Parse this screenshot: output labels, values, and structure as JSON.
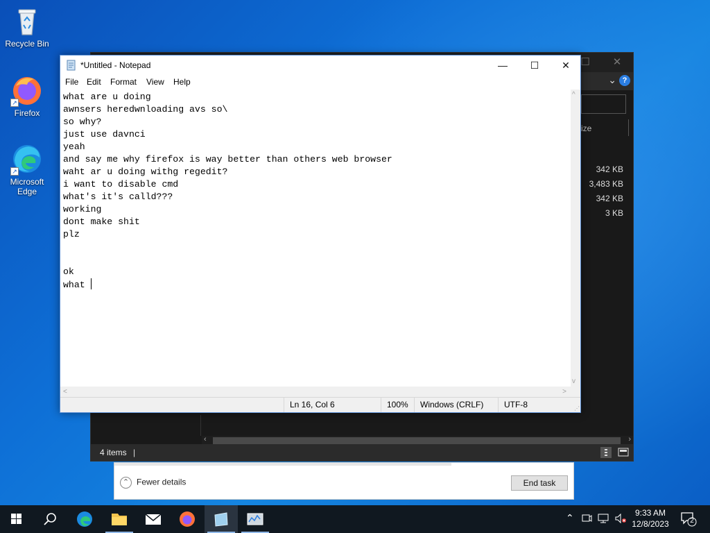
{
  "desktop": {
    "icons": [
      {
        "label": "Recycle Bin"
      },
      {
        "label": "Firefox"
      },
      {
        "label": "Microsoft Edge"
      }
    ]
  },
  "explorer": {
    "column_header": "ize",
    "sizes": [
      "342 KB",
      "3,483 KB",
      "342 KB",
      "3 KB"
    ],
    "status_items": "4 items",
    "status_sep": "|",
    "help_icon": "?"
  },
  "taskmgr": {
    "fewer_details": "Fewer details",
    "end_task": "End task"
  },
  "notepad": {
    "title": "*Untitled - Notepad",
    "menu": [
      "File",
      "Edit",
      "Format",
      "View",
      "Help"
    ],
    "lines": [
      "what are u doing",
      "awnsers heredwnloading avs so\\",
      "so why?",
      "just use davnci",
      "yeah",
      "and say me why firefox is way better than others web browser",
      "waht ar u doing withg regedit?",
      "i want to disable cmd",
      "what's it's calld???",
      "working",
      "dont make shit",
      "plz",
      "",
      "",
      "ok",
      "what "
    ],
    "status": {
      "position": "Ln 16, Col 6",
      "zoom": "100%",
      "line_ending": "Windows (CRLF)",
      "encoding": "UTF-8"
    }
  },
  "taskbar": {
    "clock_time": "9:33 AM",
    "clock_date": "12/8/2023",
    "notification_count": "2"
  },
  "colors": {
    "desktop_blue": "#0e6fd6",
    "taskbar": "#101820",
    "explorer_dark": "#191919",
    "accent": "#2a7de1"
  }
}
